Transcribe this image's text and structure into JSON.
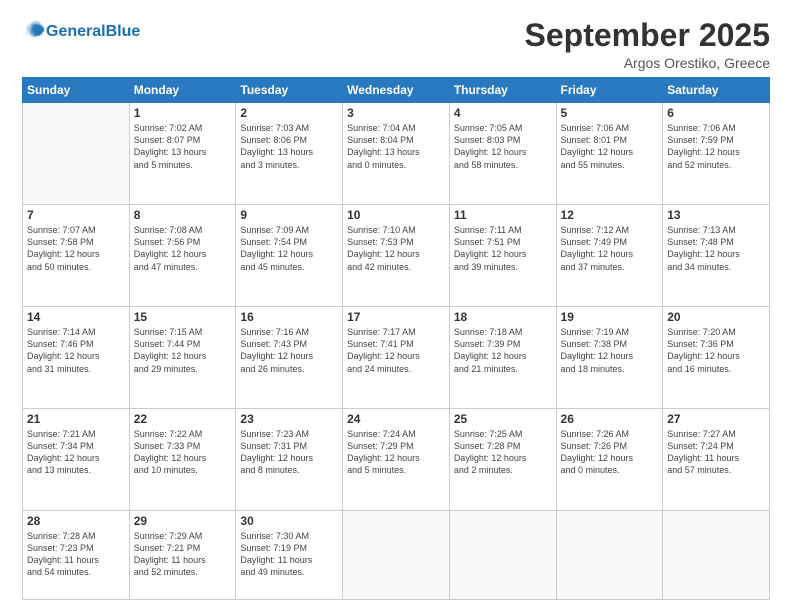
{
  "header": {
    "logo_general": "General",
    "logo_blue": "Blue",
    "month": "September 2025",
    "location": "Argos Orestiko, Greece"
  },
  "weekdays": [
    "Sunday",
    "Monday",
    "Tuesday",
    "Wednesday",
    "Thursday",
    "Friday",
    "Saturday"
  ],
  "weeks": [
    [
      {
        "day": "",
        "text": ""
      },
      {
        "day": "1",
        "text": "Sunrise: 7:02 AM\nSunset: 8:07 PM\nDaylight: 13 hours\nand 5 minutes."
      },
      {
        "day": "2",
        "text": "Sunrise: 7:03 AM\nSunset: 8:06 PM\nDaylight: 13 hours\nand 3 minutes."
      },
      {
        "day": "3",
        "text": "Sunrise: 7:04 AM\nSunset: 8:04 PM\nDaylight: 13 hours\nand 0 minutes."
      },
      {
        "day": "4",
        "text": "Sunrise: 7:05 AM\nSunset: 8:03 PM\nDaylight: 12 hours\nand 58 minutes."
      },
      {
        "day": "5",
        "text": "Sunrise: 7:06 AM\nSunset: 8:01 PM\nDaylight: 12 hours\nand 55 minutes."
      },
      {
        "day": "6",
        "text": "Sunrise: 7:06 AM\nSunset: 7:59 PM\nDaylight: 12 hours\nand 52 minutes."
      }
    ],
    [
      {
        "day": "7",
        "text": "Sunrise: 7:07 AM\nSunset: 7:58 PM\nDaylight: 12 hours\nand 50 minutes."
      },
      {
        "day": "8",
        "text": "Sunrise: 7:08 AM\nSunset: 7:56 PM\nDaylight: 12 hours\nand 47 minutes."
      },
      {
        "day": "9",
        "text": "Sunrise: 7:09 AM\nSunset: 7:54 PM\nDaylight: 12 hours\nand 45 minutes."
      },
      {
        "day": "10",
        "text": "Sunrise: 7:10 AM\nSunset: 7:53 PM\nDaylight: 12 hours\nand 42 minutes."
      },
      {
        "day": "11",
        "text": "Sunrise: 7:11 AM\nSunset: 7:51 PM\nDaylight: 12 hours\nand 39 minutes."
      },
      {
        "day": "12",
        "text": "Sunrise: 7:12 AM\nSunset: 7:49 PM\nDaylight: 12 hours\nand 37 minutes."
      },
      {
        "day": "13",
        "text": "Sunrise: 7:13 AM\nSunset: 7:48 PM\nDaylight: 12 hours\nand 34 minutes."
      }
    ],
    [
      {
        "day": "14",
        "text": "Sunrise: 7:14 AM\nSunset: 7:46 PM\nDaylight: 12 hours\nand 31 minutes."
      },
      {
        "day": "15",
        "text": "Sunrise: 7:15 AM\nSunset: 7:44 PM\nDaylight: 12 hours\nand 29 minutes."
      },
      {
        "day": "16",
        "text": "Sunrise: 7:16 AM\nSunset: 7:43 PM\nDaylight: 12 hours\nand 26 minutes."
      },
      {
        "day": "17",
        "text": "Sunrise: 7:17 AM\nSunset: 7:41 PM\nDaylight: 12 hours\nand 24 minutes."
      },
      {
        "day": "18",
        "text": "Sunrise: 7:18 AM\nSunset: 7:39 PM\nDaylight: 12 hours\nand 21 minutes."
      },
      {
        "day": "19",
        "text": "Sunrise: 7:19 AM\nSunset: 7:38 PM\nDaylight: 12 hours\nand 18 minutes."
      },
      {
        "day": "20",
        "text": "Sunrise: 7:20 AM\nSunset: 7:36 PM\nDaylight: 12 hours\nand 16 minutes."
      }
    ],
    [
      {
        "day": "21",
        "text": "Sunrise: 7:21 AM\nSunset: 7:34 PM\nDaylight: 12 hours\nand 13 minutes."
      },
      {
        "day": "22",
        "text": "Sunrise: 7:22 AM\nSunset: 7:33 PM\nDaylight: 12 hours\nand 10 minutes."
      },
      {
        "day": "23",
        "text": "Sunrise: 7:23 AM\nSunset: 7:31 PM\nDaylight: 12 hours\nand 8 minutes."
      },
      {
        "day": "24",
        "text": "Sunrise: 7:24 AM\nSunset: 7:29 PM\nDaylight: 12 hours\nand 5 minutes."
      },
      {
        "day": "25",
        "text": "Sunrise: 7:25 AM\nSunset: 7:28 PM\nDaylight: 12 hours\nand 2 minutes."
      },
      {
        "day": "26",
        "text": "Sunrise: 7:26 AM\nSunset: 7:26 PM\nDaylight: 12 hours\nand 0 minutes."
      },
      {
        "day": "27",
        "text": "Sunrise: 7:27 AM\nSunset: 7:24 PM\nDaylight: 11 hours\nand 57 minutes."
      }
    ],
    [
      {
        "day": "28",
        "text": "Sunrise: 7:28 AM\nSunset: 7:23 PM\nDaylight: 11 hours\nand 54 minutes."
      },
      {
        "day": "29",
        "text": "Sunrise: 7:29 AM\nSunset: 7:21 PM\nDaylight: 11 hours\nand 52 minutes."
      },
      {
        "day": "30",
        "text": "Sunrise: 7:30 AM\nSunset: 7:19 PM\nDaylight: 11 hours\nand 49 minutes."
      },
      {
        "day": "",
        "text": ""
      },
      {
        "day": "",
        "text": ""
      },
      {
        "day": "",
        "text": ""
      },
      {
        "day": "",
        "text": ""
      }
    ]
  ]
}
